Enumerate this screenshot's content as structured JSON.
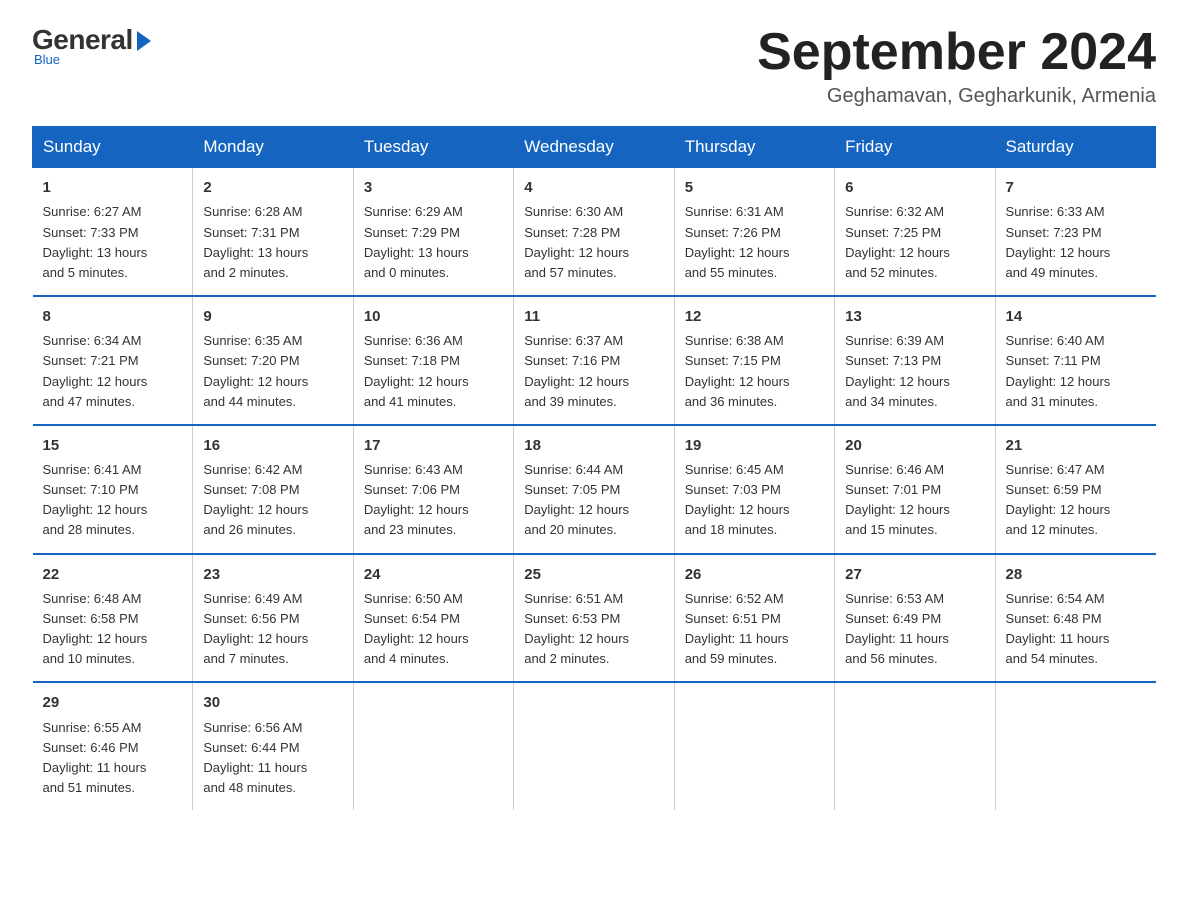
{
  "logo": {
    "general": "General",
    "blue": "Blue",
    "sub": "Blue"
  },
  "title": "September 2024",
  "location": "Geghamavan, Gegharkunik, Armenia",
  "days_of_week": [
    "Sunday",
    "Monday",
    "Tuesday",
    "Wednesday",
    "Thursday",
    "Friday",
    "Saturday"
  ],
  "weeks": [
    [
      {
        "day": "1",
        "sunrise": "6:27 AM",
        "sunset": "7:33 PM",
        "daylight": "13 hours and 5 minutes."
      },
      {
        "day": "2",
        "sunrise": "6:28 AM",
        "sunset": "7:31 PM",
        "daylight": "13 hours and 2 minutes."
      },
      {
        "day": "3",
        "sunrise": "6:29 AM",
        "sunset": "7:29 PM",
        "daylight": "13 hours and 0 minutes."
      },
      {
        "day": "4",
        "sunrise": "6:30 AM",
        "sunset": "7:28 PM",
        "daylight": "12 hours and 57 minutes."
      },
      {
        "day": "5",
        "sunrise": "6:31 AM",
        "sunset": "7:26 PM",
        "daylight": "12 hours and 55 minutes."
      },
      {
        "day": "6",
        "sunrise": "6:32 AM",
        "sunset": "7:25 PM",
        "daylight": "12 hours and 52 minutes."
      },
      {
        "day": "7",
        "sunrise": "6:33 AM",
        "sunset": "7:23 PM",
        "daylight": "12 hours and 49 minutes."
      }
    ],
    [
      {
        "day": "8",
        "sunrise": "6:34 AM",
        "sunset": "7:21 PM",
        "daylight": "12 hours and 47 minutes."
      },
      {
        "day": "9",
        "sunrise": "6:35 AM",
        "sunset": "7:20 PM",
        "daylight": "12 hours and 44 minutes."
      },
      {
        "day": "10",
        "sunrise": "6:36 AM",
        "sunset": "7:18 PM",
        "daylight": "12 hours and 41 minutes."
      },
      {
        "day": "11",
        "sunrise": "6:37 AM",
        "sunset": "7:16 PM",
        "daylight": "12 hours and 39 minutes."
      },
      {
        "day": "12",
        "sunrise": "6:38 AM",
        "sunset": "7:15 PM",
        "daylight": "12 hours and 36 minutes."
      },
      {
        "day": "13",
        "sunrise": "6:39 AM",
        "sunset": "7:13 PM",
        "daylight": "12 hours and 34 minutes."
      },
      {
        "day": "14",
        "sunrise": "6:40 AM",
        "sunset": "7:11 PM",
        "daylight": "12 hours and 31 minutes."
      }
    ],
    [
      {
        "day": "15",
        "sunrise": "6:41 AM",
        "sunset": "7:10 PM",
        "daylight": "12 hours and 28 minutes."
      },
      {
        "day": "16",
        "sunrise": "6:42 AM",
        "sunset": "7:08 PM",
        "daylight": "12 hours and 26 minutes."
      },
      {
        "day": "17",
        "sunrise": "6:43 AM",
        "sunset": "7:06 PM",
        "daylight": "12 hours and 23 minutes."
      },
      {
        "day": "18",
        "sunrise": "6:44 AM",
        "sunset": "7:05 PM",
        "daylight": "12 hours and 20 minutes."
      },
      {
        "day": "19",
        "sunrise": "6:45 AM",
        "sunset": "7:03 PM",
        "daylight": "12 hours and 18 minutes."
      },
      {
        "day": "20",
        "sunrise": "6:46 AM",
        "sunset": "7:01 PM",
        "daylight": "12 hours and 15 minutes."
      },
      {
        "day": "21",
        "sunrise": "6:47 AM",
        "sunset": "6:59 PM",
        "daylight": "12 hours and 12 minutes."
      }
    ],
    [
      {
        "day": "22",
        "sunrise": "6:48 AM",
        "sunset": "6:58 PM",
        "daylight": "12 hours and 10 minutes."
      },
      {
        "day": "23",
        "sunrise": "6:49 AM",
        "sunset": "6:56 PM",
        "daylight": "12 hours and 7 minutes."
      },
      {
        "day": "24",
        "sunrise": "6:50 AM",
        "sunset": "6:54 PM",
        "daylight": "12 hours and 4 minutes."
      },
      {
        "day": "25",
        "sunrise": "6:51 AM",
        "sunset": "6:53 PM",
        "daylight": "12 hours and 2 minutes."
      },
      {
        "day": "26",
        "sunrise": "6:52 AM",
        "sunset": "6:51 PM",
        "daylight": "11 hours and 59 minutes."
      },
      {
        "day": "27",
        "sunrise": "6:53 AM",
        "sunset": "6:49 PM",
        "daylight": "11 hours and 56 minutes."
      },
      {
        "day": "28",
        "sunrise": "6:54 AM",
        "sunset": "6:48 PM",
        "daylight": "11 hours and 54 minutes."
      }
    ],
    [
      {
        "day": "29",
        "sunrise": "6:55 AM",
        "sunset": "6:46 PM",
        "daylight": "11 hours and 51 minutes."
      },
      {
        "day": "30",
        "sunrise": "6:56 AM",
        "sunset": "6:44 PM",
        "daylight": "11 hours and 48 minutes."
      },
      {
        "day": "",
        "sunrise": "",
        "sunset": "",
        "daylight": ""
      },
      {
        "day": "",
        "sunrise": "",
        "sunset": "",
        "daylight": ""
      },
      {
        "day": "",
        "sunrise": "",
        "sunset": "",
        "daylight": ""
      },
      {
        "day": "",
        "sunrise": "",
        "sunset": "",
        "daylight": ""
      },
      {
        "day": "",
        "sunrise": "",
        "sunset": "",
        "daylight": ""
      }
    ]
  ]
}
